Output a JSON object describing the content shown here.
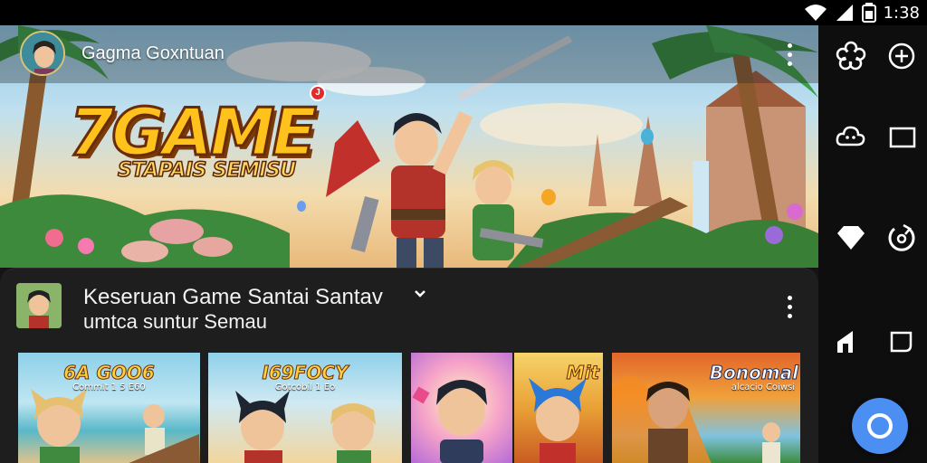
{
  "status_bar": {
    "time": "1:38",
    "icons": [
      "wifi-icon",
      "signal-icon",
      "battery-icon"
    ]
  },
  "hero": {
    "channel_name": "Gagma Goxntuan",
    "logo_title": "7GAME",
    "logo_subtitle": "STAPAIS SEMISU",
    "badge": "J"
  },
  "card": {
    "title": "Keseruan Game Santai Santav",
    "subtitle": "umtca suntur Semau"
  },
  "tiles": [
    {
      "title": "6A GOO6",
      "subtitle": "Commit 1 5 E60"
    },
    {
      "title": "I69FOCY",
      "subtitle": "Gotcobil 1 Eo"
    },
    {
      "title": "",
      "subtitle": ""
    },
    {
      "title": "Mit",
      "subtitle": ""
    },
    {
      "title": "Bonomal",
      "subtitle": "alcacio Coiwsi"
    }
  ],
  "right_nav": {
    "icons": [
      "flower-icon",
      "add-circle-icon",
      "cloud-icon",
      "square-icon",
      "diamond-icon",
      "refresh-icon",
      "home-icon",
      "rounded-square-icon"
    ]
  },
  "colors": {
    "accent_blue": "#4b8ff2",
    "logo_gold": "#ffc21c",
    "card_bg": "#1e1e1e",
    "nav_bg": "#0e0e0e"
  }
}
